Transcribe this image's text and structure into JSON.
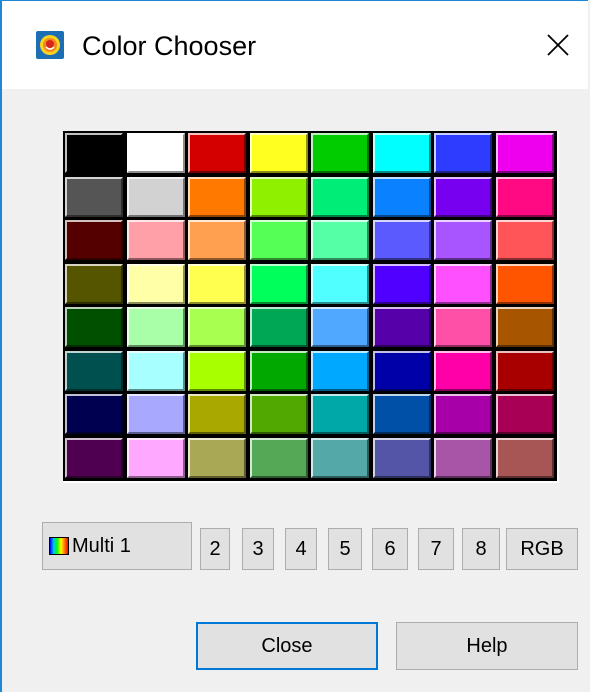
{
  "window": {
    "title": "Color Chooser",
    "icon": "color-chooser-app-icon",
    "close_icon": "close-icon"
  },
  "palette": {
    "rows": [
      [
        "#000000",
        "#ffffff",
        "#d40000",
        "#ffff20",
        "#00cc00",
        "#00ffff",
        "#2d3cff",
        "#ee00ee"
      ],
      [
        "#555555",
        "#d2d2d2",
        "#ff7800",
        "#8ff000",
        "#00ee78",
        "#0a82ff",
        "#7800f0",
        "#ff0a82"
      ],
      [
        "#550000",
        "#ffa0a8",
        "#ffa050",
        "#55ff55",
        "#55ffa5",
        "#5a5aff",
        "#a855ff",
        "#ff5558"
      ],
      [
        "#555500",
        "#ffffa8",
        "#ffff50",
        "#00ff5a",
        "#50ffff",
        "#5000ff",
        "#ff50ff",
        "#ff5500"
      ],
      [
        "#005000",
        "#a8ffa8",
        "#a8ff50",
        "#00a855",
        "#50a8ff",
        "#5500a8",
        "#ff50a8",
        "#a85500"
      ],
      [
        "#005050",
        "#a8ffff",
        "#a8ff00",
        "#00a800",
        "#00a8ff",
        "#0000a8",
        "#ff00a8",
        "#a80000"
      ],
      [
        "#000050",
        "#a8a8ff",
        "#a8a800",
        "#50a800",
        "#00a8a8",
        "#0050a8",
        "#a800a8",
        "#a80055"
      ],
      [
        "#500050",
        "#ffa8ff",
        "#a8a855",
        "#55a855",
        "#55a8a8",
        "#5555a8",
        "#a855a8",
        "#a85555"
      ]
    ]
  },
  "tabs": {
    "multi_label": "Multi 1",
    "numbers": [
      "2",
      "3",
      "4",
      "5",
      "6",
      "7",
      "8"
    ],
    "rgb_label": "RGB"
  },
  "buttons": {
    "close_label": "Close",
    "help_label": "Help"
  }
}
